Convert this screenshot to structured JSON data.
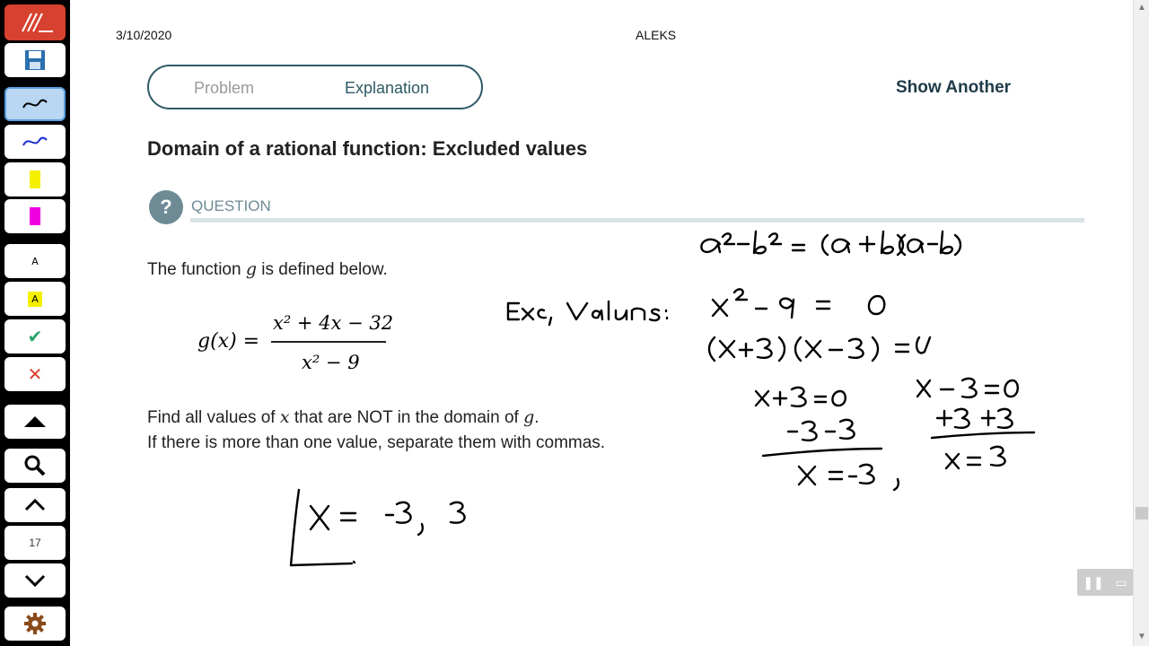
{
  "toolbar": {
    "items": [
      {
        "name": "logo",
        "glyph": ""
      },
      {
        "name": "save",
        "glyph": "💾"
      },
      {
        "name": "pen-black",
        "glyph": "〜"
      },
      {
        "name": "pen-blue",
        "glyph": "〜"
      },
      {
        "name": "highlighter-yellow",
        "glyph": ""
      },
      {
        "name": "highlighter-magenta",
        "glyph": ""
      },
      {
        "name": "text-tool",
        "glyph": "A"
      },
      {
        "name": "text-highlight",
        "glyph": "A"
      },
      {
        "name": "check",
        "glyph": "✔"
      },
      {
        "name": "cross",
        "glyph": "✕"
      },
      {
        "name": "eject",
        "glyph": "⏏"
      },
      {
        "name": "zoom",
        "glyph": "🔍"
      },
      {
        "name": "page-up",
        "glyph": "⌃"
      },
      {
        "name": "page-number",
        "glyph": "17"
      },
      {
        "name": "page-down",
        "glyph": "⌄"
      },
      {
        "name": "settings",
        "glyph": "⚙"
      }
    ]
  },
  "header": {
    "date": "3/10/2020",
    "app": "ALEKS"
  },
  "tabs": {
    "problem": "Problem",
    "explanation": "Explanation"
  },
  "actions": {
    "show_another": "Show Another"
  },
  "title": "Domain of a rational function: Excluded values",
  "question": {
    "label": "QUESTION",
    "line1_pre": "The function ",
    "line1_var": "g",
    "line1_post": " is defined below.",
    "fn_lhs": "g(x) =",
    "fn_num": "x² + 4x − 32",
    "fn_den": "x² − 9",
    "find_pre": "Find all values of ",
    "find_var": "x",
    "find_mid": " that are NOT in the domain of ",
    "find_var2": "g",
    "find_end": ".",
    "line3": "If there is more than one value, separate them with commas."
  },
  "handwriting": {
    "identity": "a² − b² = (a+b)(a−b)",
    "exc_label": "Exc. Values:",
    "eq1": "x² − 9 = 0",
    "factored": "(x+3)(x−3) = 0",
    "left_work": "x+3=0  −3 −3  x = −3",
    "right_work": "x−3=0  +3 +3  x = 3",
    "answer": "x = −3, 3"
  },
  "colors": {
    "accent": "#2e5a66",
    "question_gray": "#6d8a95",
    "logo_red": "#d7412f"
  }
}
